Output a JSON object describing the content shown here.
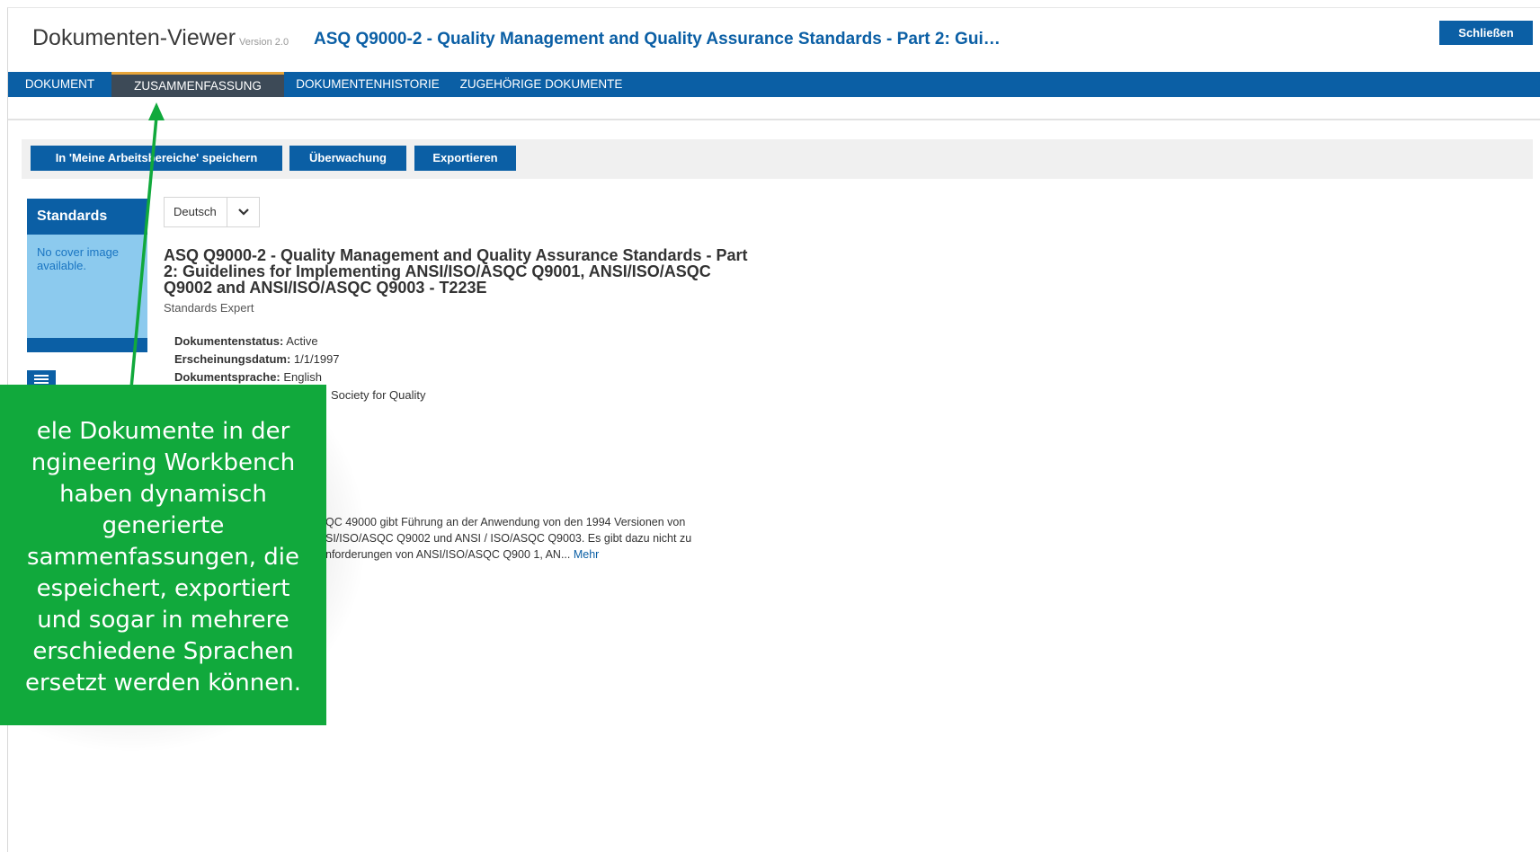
{
  "header": {
    "app_title": "Dokumenten-Viewer",
    "version": "Version 2.0",
    "doc_title": "ASQ Q9000-2 - Quality Management and Quality Assurance Standards - Part 2: Gui…",
    "close_label": "Schließen"
  },
  "tabs": [
    {
      "label": "DOKUMENT",
      "active": false
    },
    {
      "label": "ZUSAMMENFASSUNG",
      "active": true
    },
    {
      "label": "DOKUMENTENHISTORIE",
      "active": false
    },
    {
      "label": "ZUGEHÖRIGE DOKUMENTE",
      "active": false
    }
  ],
  "toolbar": {
    "save_label": "In 'Meine Arbeitsbereiche' speichern",
    "monitor_label": "Überwachung",
    "export_label": "Exportieren"
  },
  "sidebar": {
    "heading": "Standards",
    "no_cover": "No cover image available."
  },
  "language": {
    "selected": "Deutsch"
  },
  "document": {
    "heading": "ASQ Q9000-2 - Quality Management and Quality Assurance Standards - Part 2: Guidelines for Implementing ANSI/ISO/ASQC Q9001, ANSI/ISO/ASQC Q9002 and ANSI/ISO/ASQC Q9003 - T223E",
    "source": "Standards Expert",
    "meta": [
      {
        "label": "Dokumentenstatus:",
        "value": "Active"
      },
      {
        "label": "Erscheinungsdatum:",
        "value": "1/1/1997"
      },
      {
        "label": "Dokumentsprache:",
        "value": "English"
      },
      {
        "label": "",
        "value": "Society for Quality"
      }
    ],
    "summary_text": "QC 49000 gibt Führung an der Anwendung von den 1994 Versionen von \nSI/ISO/ASQC Q9002 und ANSI / ISO/ASQC Q9003. Es gibt dazu nicht zu \nnforderungen von ANSI/ISO/ASQC Q900 1, AN...",
    "more_label": "Mehr"
  },
  "callout": {
    "text": "ele Dokumente in der\nngineering Workbench\nhaben dynamisch\ngenerierte\nsammenfassungen, die\nespeichert, exportiert\nund sogar in mehrere\nerschiedene Sprachen\nersetzt werden können."
  },
  "colors": {
    "brand": "#0b5fa5",
    "callout": "#11a93c",
    "active_tab_accent": "#e8a53a"
  }
}
